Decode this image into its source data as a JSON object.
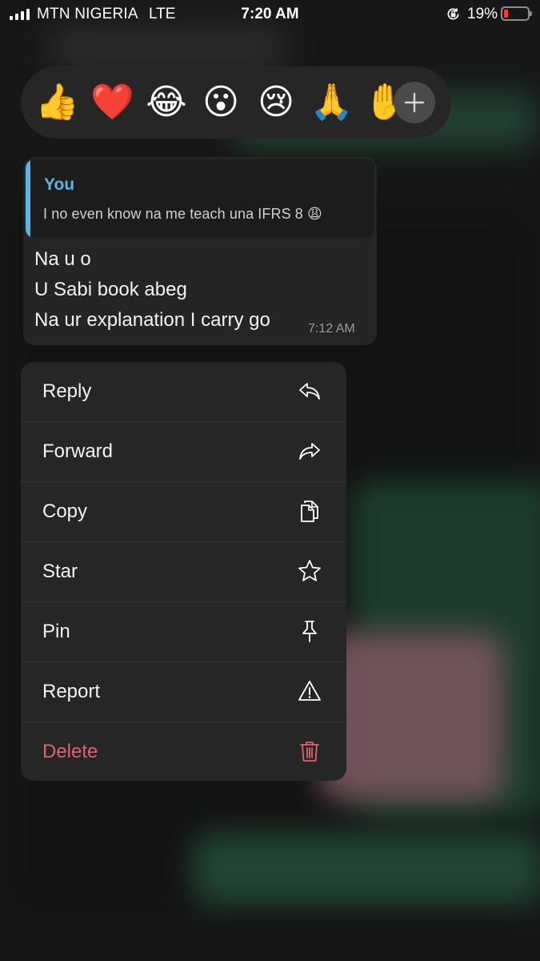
{
  "status_bar": {
    "carrier": "MTN NIGERIA",
    "network": "LTE",
    "time": "7:20 AM",
    "battery_percent": "19%",
    "battery_level": 0.19,
    "battery_color": "#ff3b30"
  },
  "reactions": {
    "emojis": [
      "👍",
      "❤️",
      "😂",
      "😮",
      "😢",
      "🙏",
      "✋"
    ],
    "add_icon": "plus-icon"
  },
  "message": {
    "quote": {
      "author": "You",
      "text": "I no even know na me teach una IFRS 8 😩"
    },
    "lines": [
      "Na u o",
      "U Sabi book abeg",
      "Na ur explanation I carry go"
    ],
    "time": "7:12 AM",
    "quote_accent": "#5ab4e6"
  },
  "menu": {
    "items": [
      {
        "label": "Reply",
        "icon": "reply-icon"
      },
      {
        "label": "Forward",
        "icon": "forward-icon"
      },
      {
        "label": "Copy",
        "icon": "copy-icon"
      },
      {
        "label": "Star",
        "icon": "star-icon"
      },
      {
        "label": "Pin",
        "icon": "pin-icon"
      },
      {
        "label": "Report",
        "icon": "warning-icon"
      },
      {
        "label": "Delete",
        "icon": "trash-icon"
      }
    ],
    "danger_color": "#e0636b"
  }
}
